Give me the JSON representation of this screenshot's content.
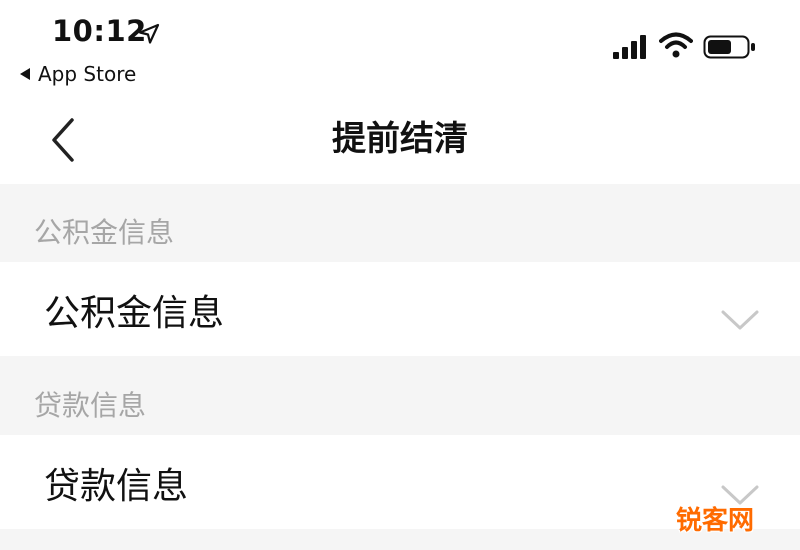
{
  "status_bar": {
    "time": "10:12",
    "back_app_label": "App Store",
    "icons": [
      "location-arrow-icon",
      "cellular-signal-icon",
      "wifi-icon",
      "battery-icon"
    ]
  },
  "nav": {
    "title": "提前结清",
    "back_icon": "chevron-left-icon"
  },
  "sections": [
    {
      "header": "公积金信息",
      "field_value": "公积金信息",
      "expand_icon": "chevron-down-icon"
    },
    {
      "header": "贷款信息",
      "field_value": "贷款信息",
      "expand_icon": "chevron-down-icon"
    }
  ],
  "watermark": "锐客网",
  "colors": {
    "page_background": "#f5f5f5",
    "card_background": "#ffffff",
    "header_text": "#a6a6a6",
    "primary_text": "#111111",
    "chevron": "#c8c8c8",
    "watermark": "#ff6b00"
  }
}
